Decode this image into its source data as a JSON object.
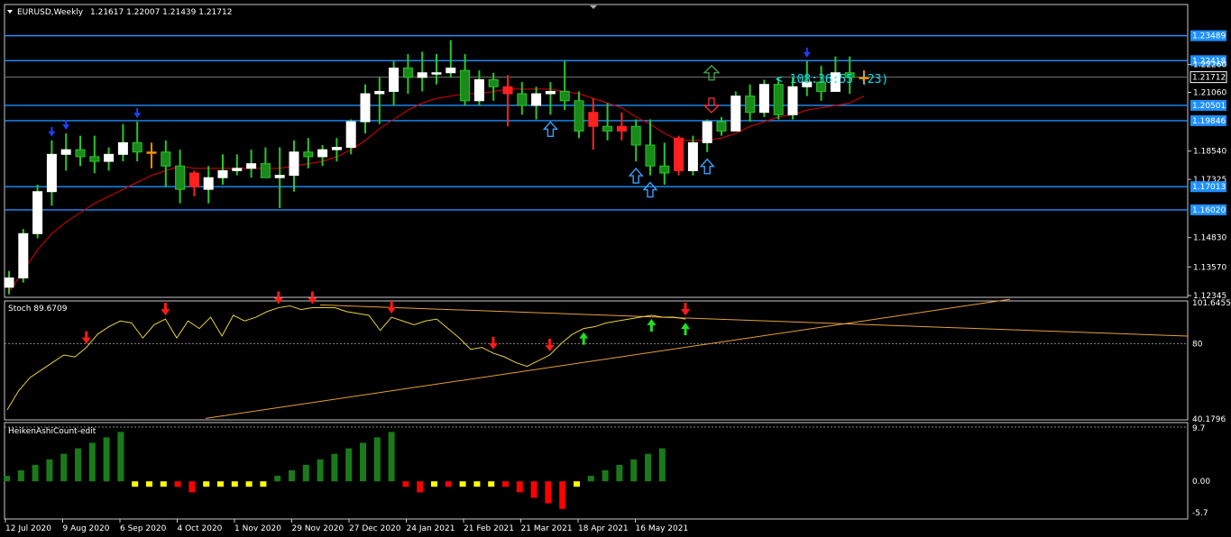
{
  "chart_data": {
    "type": "candlestick",
    "symbol": "EURUSD,Weekly",
    "ohlc_text": "1.21617 1.22007 1.21439 1.21712",
    "timer_text": "< 108:36:55 (23)",
    "price_ticks": [
      "1.23489",
      "1.22418",
      "1.22260",
      "1.21712",
      "1.21060",
      "1.20501",
      "1.19846",
      "1.18540",
      "1.17325",
      "1.17013",
      "1.16020",
      "1.14830",
      "1.13570",
      "1.12345"
    ],
    "ylim": [
      1.12345,
      1.2475
    ],
    "hlines": [
      1.23489,
      1.22418,
      1.20501,
      1.19846,
      1.17013,
      1.1602
    ],
    "current_price": 1.21712,
    "candles": [
      {
        "o": 1.127,
        "h": 1.134,
        "l": 1.124,
        "c": 1.131,
        "t": "up"
      },
      {
        "o": 1.131,
        "h": 1.152,
        "l": 1.129,
        "c": 1.15,
        "t": "up"
      },
      {
        "o": 1.15,
        "h": 1.171,
        "l": 1.148,
        "c": 1.168,
        "t": "up"
      },
      {
        "o": 1.168,
        "h": 1.19,
        "l": 1.162,
        "c": 1.184,
        "t": "up"
      },
      {
        "o": 1.184,
        "h": 1.193,
        "l": 1.177,
        "c": 1.186,
        "t": "up"
      },
      {
        "o": 1.186,
        "h": 1.192,
        "l": 1.179,
        "c": 1.183,
        "t": "up"
      },
      {
        "o": 1.183,
        "h": 1.192,
        "l": 1.176,
        "c": 1.181,
        "t": "up"
      },
      {
        "o": 1.181,
        "h": 1.187,
        "l": 1.177,
        "c": 1.184,
        "t": "up"
      },
      {
        "o": 1.184,
        "h": 1.197,
        "l": 1.181,
        "c": 1.189,
        "t": "up"
      },
      {
        "o": 1.189,
        "h": 1.198,
        "l": 1.181,
        "c": 1.185,
        "t": "up"
      },
      {
        "o": 1.185,
        "h": 1.189,
        "l": 1.178,
        "c": 1.185,
        "t": "doji"
      },
      {
        "o": 1.185,
        "h": 1.19,
        "l": 1.17,
        "c": 1.179,
        "t": "up"
      },
      {
        "o": 1.179,
        "h": 1.186,
        "l": 1.163,
        "c": 1.169,
        "t": "up"
      },
      {
        "o": 1.176,
        "h": 1.177,
        "l": 1.166,
        "c": 1.17,
        "t": "down"
      },
      {
        "o": 1.169,
        "h": 1.179,
        "l": 1.163,
        "c": 1.174,
        "t": "up"
      },
      {
        "o": 1.174,
        "h": 1.184,
        "l": 1.171,
        "c": 1.177,
        "t": "up"
      },
      {
        "o": 1.177,
        "h": 1.184,
        "l": 1.175,
        "c": 1.178,
        "t": "up"
      },
      {
        "o": 1.178,
        "h": 1.186,
        "l": 1.174,
        "c": 1.18,
        "t": "up"
      },
      {
        "o": 1.18,
        "h": 1.187,
        "l": 1.174,
        "c": 1.174,
        "t": "up"
      },
      {
        "o": 1.174,
        "h": 1.187,
        "l": 1.161,
        "c": 1.175,
        "t": "up"
      },
      {
        "o": 1.175,
        "h": 1.19,
        "l": 1.168,
        "c": 1.185,
        "t": "up"
      },
      {
        "o": 1.185,
        "h": 1.191,
        "l": 1.178,
        "c": 1.183,
        "t": "up"
      },
      {
        "o": 1.183,
        "h": 1.188,
        "l": 1.179,
        "c": 1.186,
        "t": "up"
      },
      {
        "o": 1.186,
        "h": 1.191,
        "l": 1.181,
        "c": 1.187,
        "t": "up"
      },
      {
        "o": 1.187,
        "h": 1.199,
        "l": 1.184,
        "c": 1.198,
        "t": "up"
      },
      {
        "o": 1.198,
        "h": 1.214,
        "l": 1.193,
        "c": 1.21,
        "t": "up"
      },
      {
        "o": 1.21,
        "h": 1.217,
        "l": 1.197,
        "c": 1.211,
        "t": "up"
      },
      {
        "o": 1.211,
        "h": 1.224,
        "l": 1.205,
        "c": 1.221,
        "t": "up"
      },
      {
        "o": 1.221,
        "h": 1.227,
        "l": 1.21,
        "c": 1.217,
        "t": "up"
      },
      {
        "o": 1.217,
        "h": 1.228,
        "l": 1.211,
        "c": 1.219,
        "t": "up"
      },
      {
        "o": 1.219,
        "h": 1.227,
        "l": 1.214,
        "c": 1.219,
        "t": "up"
      },
      {
        "o": 1.219,
        "h": 1.233,
        "l": 1.217,
        "c": 1.221,
        "t": "up"
      },
      {
        "o": 1.22,
        "h": 1.227,
        "l": 1.205,
        "c": 1.207,
        "t": "up"
      },
      {
        "o": 1.207,
        "h": 1.22,
        "l": 1.205,
        "c": 1.216,
        "t": "up"
      },
      {
        "o": 1.216,
        "h": 1.219,
        "l": 1.207,
        "c": 1.213,
        "t": "up"
      },
      {
        "o": 1.213,
        "h": 1.218,
        "l": 1.196,
        "c": 1.21,
        "t": "down"
      },
      {
        "o": 1.21,
        "h": 1.215,
        "l": 1.201,
        "c": 1.205,
        "t": "up"
      },
      {
        "o": 1.205,
        "h": 1.213,
        "l": 1.199,
        "c": 1.21,
        "t": "up"
      },
      {
        "o": 1.21,
        "h": 1.215,
        "l": 1.201,
        "c": 1.211,
        "t": "up"
      },
      {
        "o": 1.211,
        "h": 1.224,
        "l": 1.203,
        "c": 1.207,
        "t": "up"
      },
      {
        "o": 1.207,
        "h": 1.211,
        "l": 1.191,
        "c": 1.194,
        "t": "up"
      },
      {
        "o": 1.202,
        "h": 1.208,
        "l": 1.186,
        "c": 1.196,
        "t": "down"
      },
      {
        "o": 1.196,
        "h": 1.206,
        "l": 1.19,
        "c": 1.194,
        "t": "up"
      },
      {
        "o": 1.194,
        "h": 1.202,
        "l": 1.19,
        "c": 1.196,
        "t": "down"
      },
      {
        "o": 1.196,
        "h": 1.199,
        "l": 1.181,
        "c": 1.188,
        "t": "up"
      },
      {
        "o": 1.188,
        "h": 1.199,
        "l": 1.175,
        "c": 1.179,
        "t": "up"
      },
      {
        "o": 1.179,
        "h": 1.189,
        "l": 1.171,
        "c": 1.176,
        "t": "up"
      },
      {
        "o": 1.191,
        "h": 1.192,
        "l": 1.175,
        "c": 1.177,
        "t": "down"
      },
      {
        "o": 1.177,
        "h": 1.192,
        "l": 1.175,
        "c": 1.189,
        "t": "up"
      },
      {
        "o": 1.189,
        "h": 1.199,
        "l": 1.185,
        "c": 1.198,
        "t": "up"
      },
      {
        "o": 1.198,
        "h": 1.2,
        "l": 1.192,
        "c": 1.194,
        "t": "up"
      },
      {
        "o": 1.194,
        "h": 1.211,
        "l": 1.194,
        "c": 1.209,
        "t": "up"
      },
      {
        "o": 1.209,
        "h": 1.214,
        "l": 1.198,
        "c": 1.202,
        "t": "up"
      },
      {
        "o": 1.202,
        "h": 1.216,
        "l": 1.2,
        "c": 1.214,
        "t": "up"
      },
      {
        "o": 1.214,
        "h": 1.217,
        "l": 1.199,
        "c": 1.201,
        "t": "up"
      },
      {
        "o": 1.201,
        "h": 1.217,
        "l": 1.199,
        "c": 1.213,
        "t": "up"
      },
      {
        "o": 1.213,
        "h": 1.224,
        "l": 1.209,
        "c": 1.215,
        "t": "up"
      },
      {
        "o": 1.215,
        "h": 1.222,
        "l": 1.207,
        "c": 1.211,
        "t": "up"
      },
      {
        "o": 1.211,
        "h": 1.226,
        "l": 1.211,
        "c": 1.219,
        "t": "up"
      },
      {
        "o": 1.219,
        "h": 1.226,
        "l": 1.21,
        "c": 1.217,
        "t": "up"
      },
      {
        "o": 1.217,
        "h": 1.22,
        "l": 1.214,
        "c": 1.217,
        "t": "doji"
      }
    ],
    "ma_values": [
      1.125,
      1.134,
      1.143,
      1.15,
      1.155,
      1.159,
      1.163,
      1.166,
      1.169,
      1.172,
      1.175,
      1.177,
      1.179,
      1.178,
      1.178,
      1.178,
      1.178,
      1.178,
      1.178,
      1.178,
      1.179,
      1.18,
      1.181,
      1.183,
      1.186,
      1.19,
      1.195,
      1.199,
      1.203,
      1.206,
      1.208,
      1.209,
      1.21,
      1.21,
      1.211,
      1.212,
      1.212,
      1.212,
      1.212,
      1.211,
      1.21,
      1.208,
      1.206,
      1.204,
      1.2,
      1.197,
      1.193,
      1.19,
      1.19,
      1.19,
      1.191,
      1.193,
      1.196,
      1.198,
      1.2,
      1.201,
      1.203,
      1.204,
      1.205,
      1.206,
      1.209
    ],
    "blue_markers_top": [
      3,
      4,
      9,
      56
    ],
    "blue_arrows_up": [
      38,
      44,
      45,
      49
    ],
    "side_arrows": [
      {
        "dir": "up",
        "price": 1.219
      },
      {
        "dir": "down",
        "price": 1.205
      }
    ],
    "stoch": {
      "label": "Stoch 89.6709",
      "ticks": [
        "101.6455",
        "80",
        "40.1796"
      ],
      "ylim": [
        40.1796,
        101.6455
      ],
      "level": 80,
      "values": [
        45,
        55,
        62,
        66,
        70,
        74,
        73,
        78,
        85,
        89,
        92,
        91,
        83,
        90,
        93,
        83,
        92,
        88,
        94,
        84,
        95,
        92,
        94,
        97,
        99,
        100,
        98,
        99,
        99,
        99,
        97,
        96,
        95,
        87,
        94,
        92,
        90,
        92,
        93,
        88,
        83,
        77,
        78,
        75,
        73,
        70,
        68,
        71,
        74,
        80,
        85,
        88,
        89,
        91,
        92,
        93,
        94,
        95,
        94,
        94,
        93
      ],
      "red_arrows": [
        4,
        8,
        14,
        16,
        20,
        25,
        28,
        42,
        46
      ],
      "green_arrows": [
        30,
        33,
        38
      ],
      "lines": [
        {
          "from": [
            0,
            100.5
          ],
          "to": [
            80,
            84
          ]
        },
        {
          "from": [
            14,
            40.5
          ],
          "to": [
            70,
            103.5
          ]
        }
      ]
    },
    "heiken": {
      "label": "HeikenAshiCount-edit",
      "ticks": [
        "9.7",
        "0.00",
        "-5.7"
      ],
      "ylim": [
        -5.7,
        9.7
      ],
      "values": [
        1,
        2,
        3,
        4,
        5,
        6,
        7,
        8,
        9,
        -0.01,
        -0.01,
        -0.01,
        -1,
        -2,
        -0.01,
        -0.01,
        -0.01,
        -0.01,
        -0.01,
        1,
        2,
        3,
        4,
        5,
        6,
        7,
        8,
        9,
        -1,
        -2,
        -0.01,
        -1,
        -0.01,
        -0.01,
        -0.01,
        -1,
        -2,
        -3,
        -4,
        -5,
        -0.01,
        1,
        2,
        3,
        4,
        5,
        6
      ]
    },
    "x_labels": [
      "12 Jul 2020",
      "9 Aug 2020",
      "6 Sep 2020",
      "4 Oct 2020",
      "1 Nov 2020",
      "29 Nov 2020",
      "27 Dec 2020",
      "24 Jan 2021",
      "21 Feb 2021",
      "21 Mar 2021",
      "18 Apr 2021",
      "16 May 2021"
    ]
  }
}
